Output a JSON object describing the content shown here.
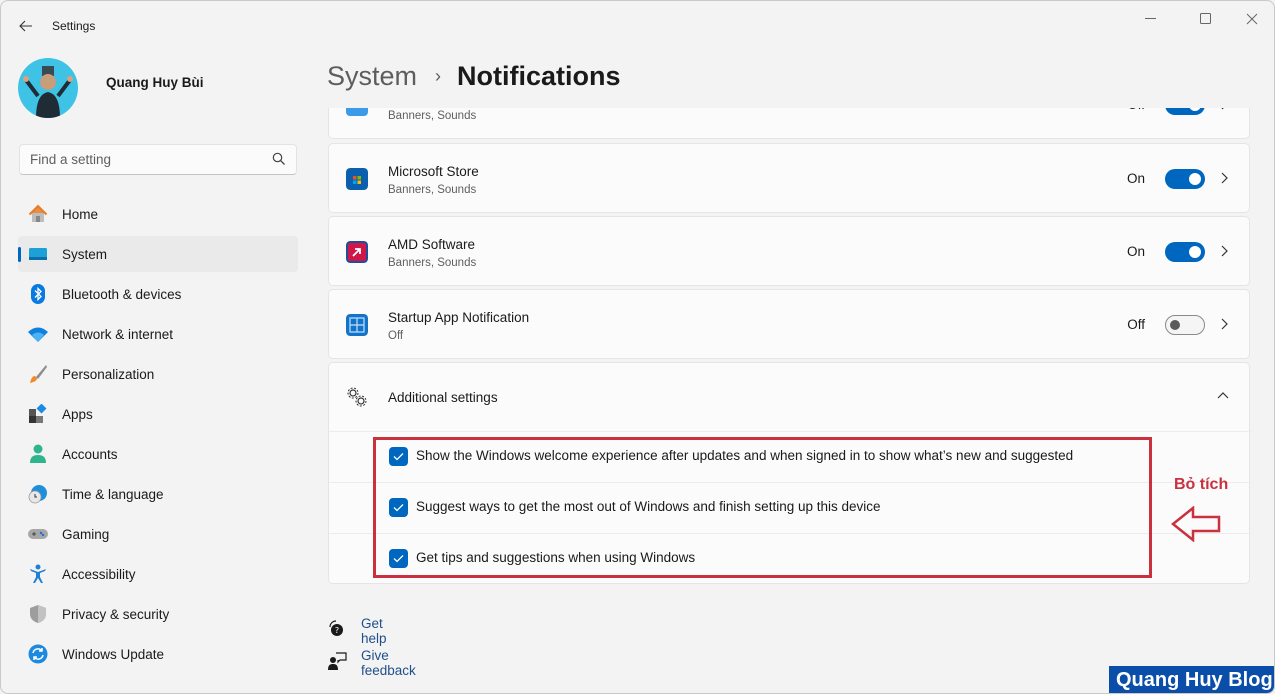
{
  "window": {
    "title": "Settings",
    "controls": {
      "minimize": "minimize-icon",
      "maximize": "maximize-icon",
      "close": "close-icon"
    }
  },
  "profile": {
    "name": "Quang Huy Bùi"
  },
  "search": {
    "placeholder": "Find a setting",
    "value": ""
  },
  "sidebar": {
    "items": [
      {
        "label": "Home",
        "icon": "home-icon",
        "active": false
      },
      {
        "label": "System",
        "icon": "system-icon",
        "active": true
      },
      {
        "label": "Bluetooth & devices",
        "icon": "bluetooth-icon",
        "active": false
      },
      {
        "label": "Network & internet",
        "icon": "wifi-icon",
        "active": false
      },
      {
        "label": "Personalization",
        "icon": "brush-icon",
        "active": false
      },
      {
        "label": "Apps",
        "icon": "apps-icon",
        "active": false
      },
      {
        "label": "Accounts",
        "icon": "account-icon",
        "active": false
      },
      {
        "label": "Time & language",
        "icon": "globe-clock-icon",
        "active": false
      },
      {
        "label": "Gaming",
        "icon": "gamepad-icon",
        "active": false
      },
      {
        "label": "Accessibility",
        "icon": "accessibility-icon",
        "active": false
      },
      {
        "label": "Privacy & security",
        "icon": "shield-icon",
        "active": false
      },
      {
        "label": "Windows Update",
        "icon": "update-icon",
        "active": false
      }
    ]
  },
  "header": {
    "parent": "System",
    "separator": "›",
    "current": "Notifications"
  },
  "apps": [
    {
      "name": "",
      "sub": "Banners, Sounds",
      "state": "Off",
      "on": true,
      "partial": true
    },
    {
      "name": "Microsoft Store",
      "sub": "Banners, Sounds",
      "state": "On",
      "on": true
    },
    {
      "name": "AMD Software",
      "sub": "Banners, Sounds",
      "state": "On",
      "on": true
    },
    {
      "name": "Startup App Notification",
      "sub": "Off",
      "state": "Off",
      "on": false
    }
  ],
  "additional": {
    "label": "Additional settings",
    "options": [
      {
        "label": "Show the Windows welcome experience after updates and when signed in to show what’s new and suggested",
        "checked": true
      },
      {
        "label": "Suggest ways to get the most out of Windows and finish setting up this device",
        "checked": true
      },
      {
        "label": "Get tips and suggestions when using Windows",
        "checked": true
      }
    ]
  },
  "annotation": {
    "text": "Bỏ tích",
    "color": "#c9313f"
  },
  "links": {
    "help": "Get help",
    "feedback": "Give feedback"
  },
  "watermark": "Quang Huy Blog",
  "colors": {
    "accent": "#0067c0",
    "background": "#f3f3f3",
    "card": "#fbfbfb"
  }
}
